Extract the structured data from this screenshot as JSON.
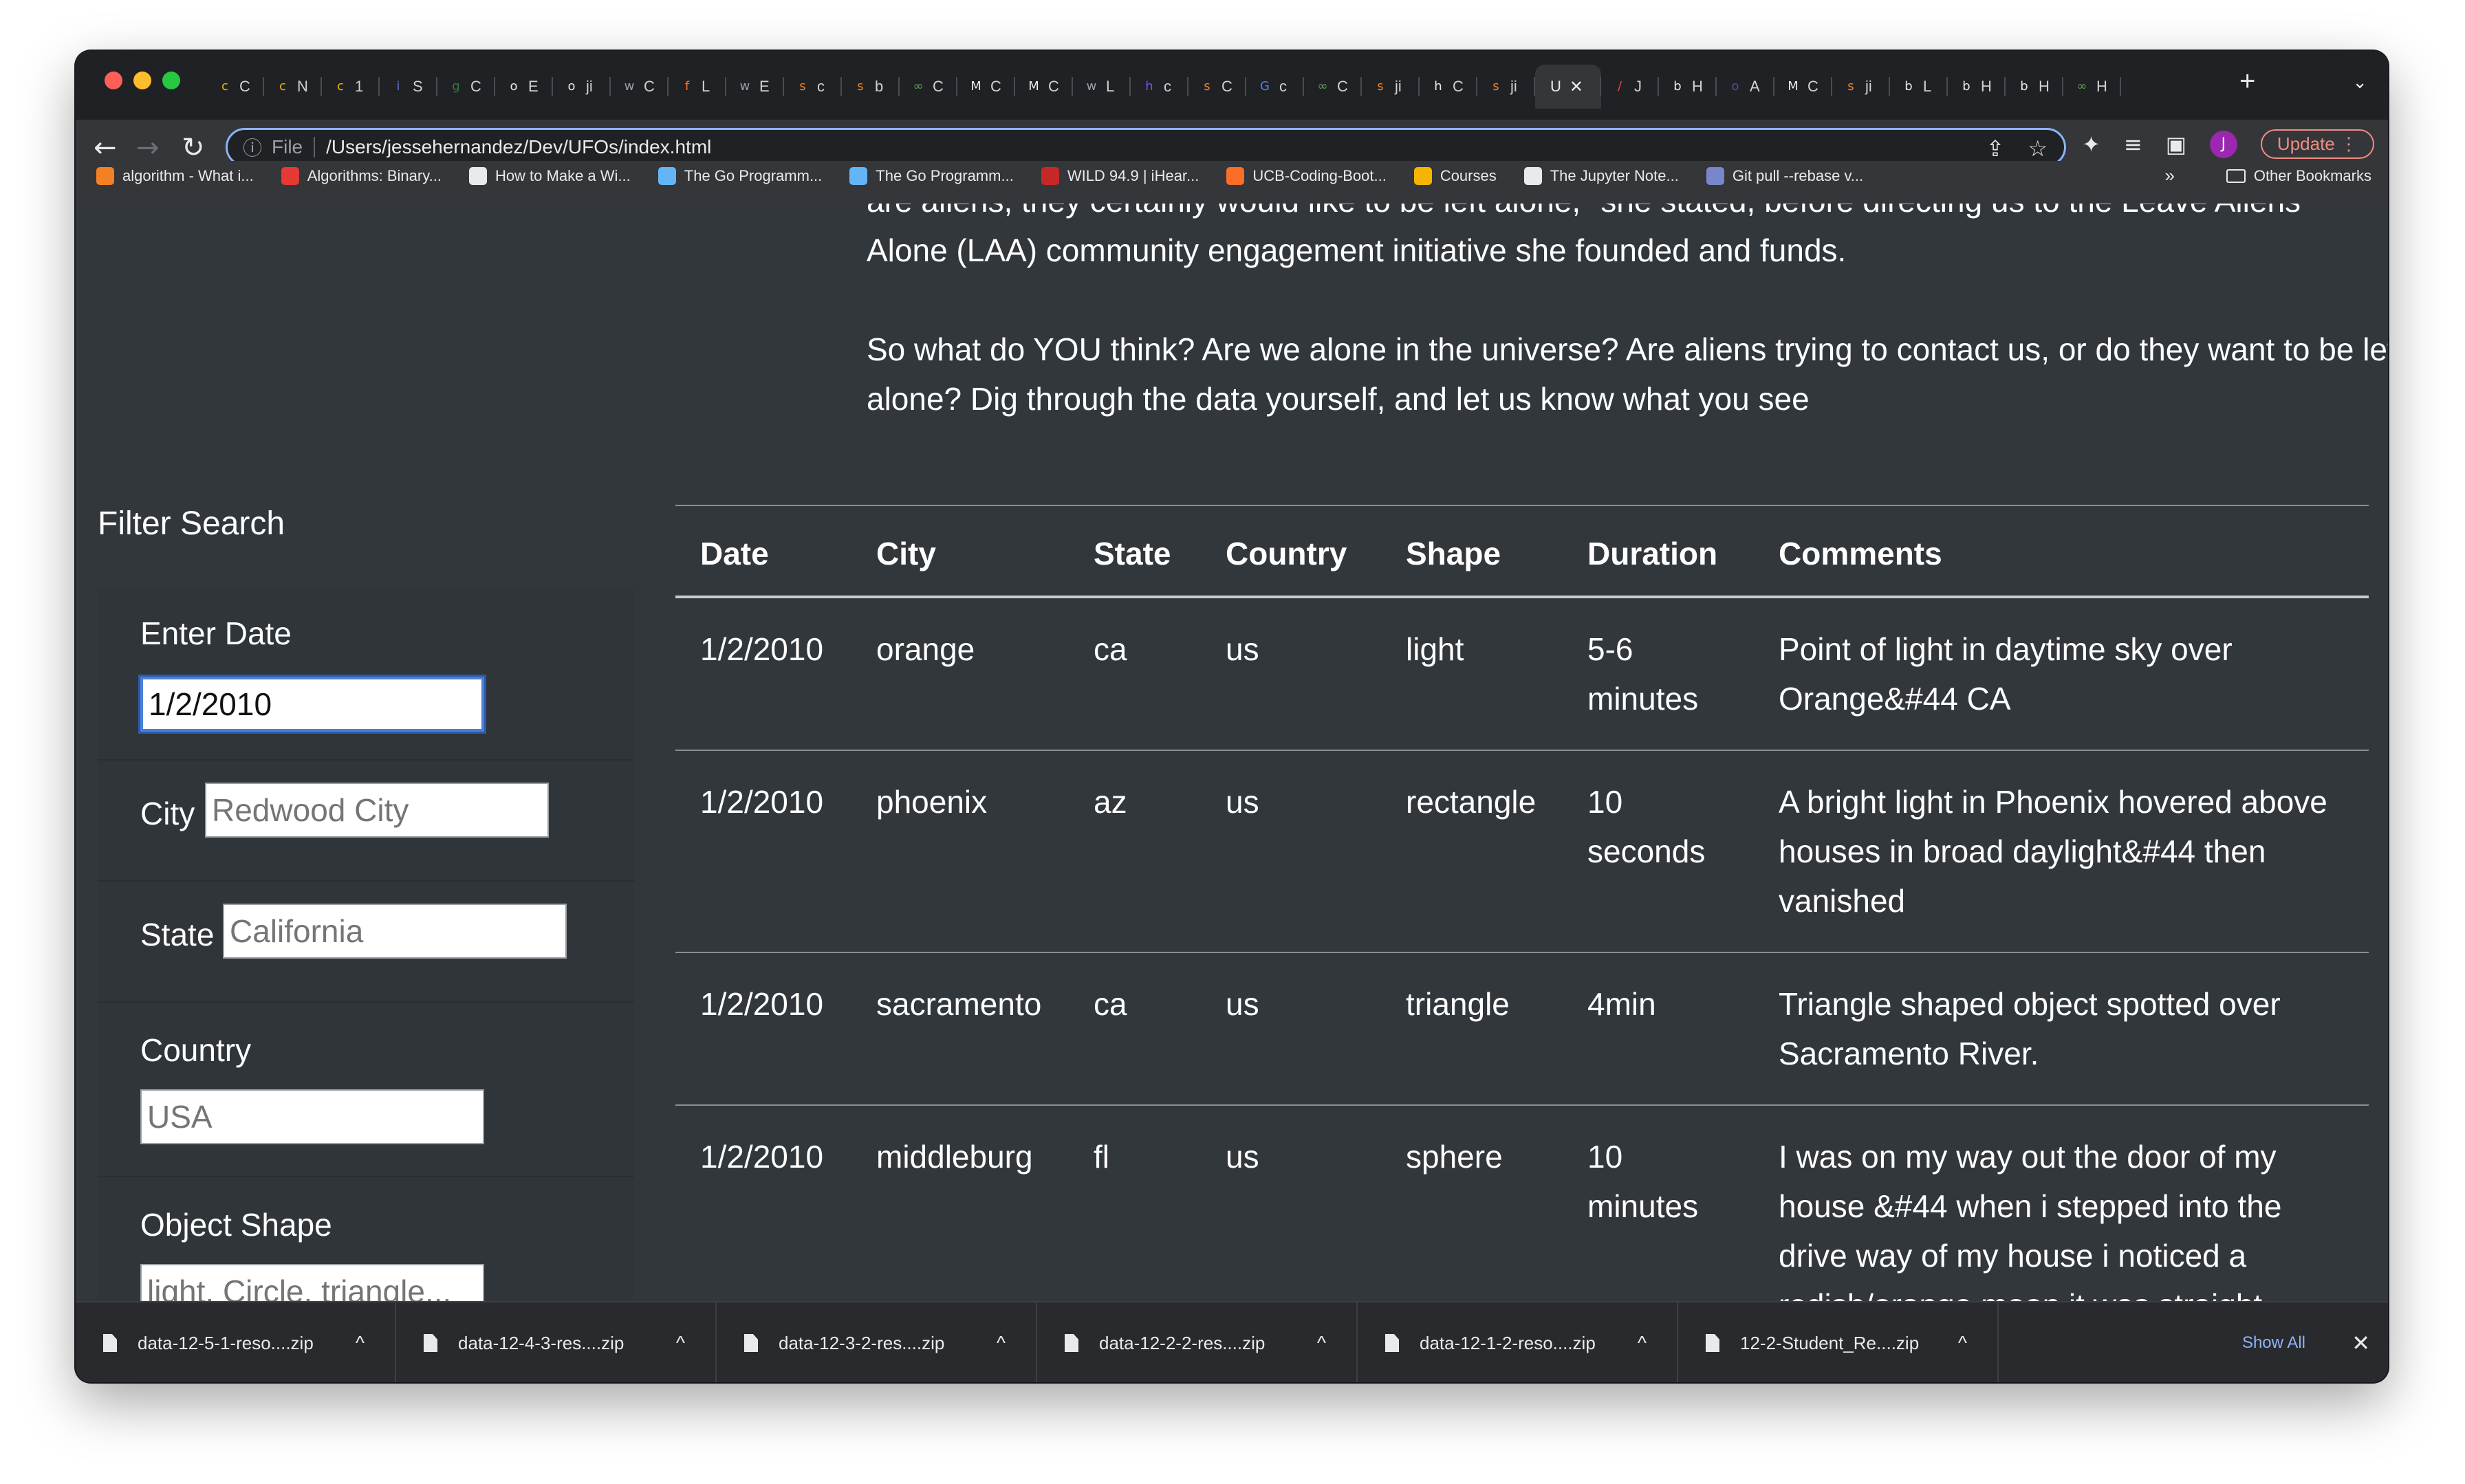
{
  "browser": {
    "tabs": [
      {
        "icon": "c",
        "label": "C",
        "color": "#f4b400"
      },
      {
        "icon": "c",
        "label": "N",
        "color": "#f4b400"
      },
      {
        "icon": "c",
        "label": "1",
        "color": "#f4b400"
      },
      {
        "icon": "i",
        "label": "S",
        "color": "#5b6fd6"
      },
      {
        "icon": "g",
        "label": "C",
        "color": "#2e7d32"
      },
      {
        "icon": "o",
        "label": "E",
        "color": "#e8eaed"
      },
      {
        "icon": "o",
        "label": "ji",
        "color": "#e8eaed"
      },
      {
        "icon": "w",
        "label": "C",
        "color": "#9aa0a6"
      },
      {
        "icon": "f",
        "label": "L",
        "color": "#fc6d26"
      },
      {
        "icon": "w",
        "label": "E",
        "color": "#9aa0a6"
      },
      {
        "icon": "s",
        "label": "c",
        "color": "#f48024"
      },
      {
        "icon": "s",
        "label": "b",
        "color": "#f48024"
      },
      {
        "icon": "∞",
        "label": "C",
        "color": "#57a64a"
      },
      {
        "icon": "M",
        "label": "C",
        "color": "#e8eaed"
      },
      {
        "icon": "M",
        "label": "C",
        "color": "#e8eaed"
      },
      {
        "icon": "w",
        "label": "L",
        "color": "#9aa0a6"
      },
      {
        "icon": "h",
        "label": "c",
        "color": "#7c4dff"
      },
      {
        "icon": "s",
        "label": "C",
        "color": "#f48024"
      },
      {
        "icon": "G",
        "label": "c",
        "color": "#4285f4"
      },
      {
        "icon": "∞",
        "label": "C",
        "color": "#57a64a"
      },
      {
        "icon": "s",
        "label": "ji",
        "color": "#f48024"
      },
      {
        "icon": "h",
        "label": "C",
        "color": "#e8eaed"
      },
      {
        "icon": "s",
        "label": "ji",
        "color": "#f48024"
      }
    ],
    "active_tab": {
      "label": "U"
    },
    "tabs_after": [
      {
        "icon": "/",
        "label": "J",
        "color": "#e74c3c"
      },
      {
        "icon": "b",
        "label": "H",
        "color": "#e8eaed"
      },
      {
        "icon": "o",
        "label": "A",
        "color": "#3f51b5"
      },
      {
        "icon": "M",
        "label": "C",
        "color": "#e8eaed"
      },
      {
        "icon": "s",
        "label": "ji",
        "color": "#f48024"
      },
      {
        "icon": "b",
        "label": "L",
        "color": "#e8eaed"
      },
      {
        "icon": "b",
        "label": "H",
        "color": "#e8eaed"
      },
      {
        "icon": "b",
        "label": "H",
        "color": "#e8eaed"
      },
      {
        "icon": "∞",
        "label": "H",
        "color": "#57a64a"
      }
    ],
    "address": {
      "scheme": "File",
      "url": "/Users/jessehernandez/Dev/UFOs/index.html"
    },
    "update_label": "Update",
    "avatar_initial": "J"
  },
  "bookmarks": {
    "items": [
      {
        "label": "algorithm - What i...",
        "color": "#f48024"
      },
      {
        "label": "Algorithms: Binary...",
        "color": "#e53935"
      },
      {
        "label": "How to Make a Wi...",
        "color": "#e8eaed"
      },
      {
        "label": "The Go Programm...",
        "color": "#64b5f6"
      },
      {
        "label": "The Go Programm...",
        "color": "#64b5f6"
      },
      {
        "label": "WILD 94.9 | iHear...",
        "color": "#c62828"
      },
      {
        "label": "UCB-Coding-Boot...",
        "color": "#fc6d26"
      },
      {
        "label": "Courses",
        "color": "#f4b400"
      },
      {
        "label": "The Jupyter Note...",
        "color": "#e8eaed"
      },
      {
        "label": "Git pull --rebase v...",
        "color": "#7986cb"
      }
    ],
    "more": "»",
    "other": "Other Bookmarks"
  },
  "article": {
    "line_partial": "are aliens, they certainly would like to be left alone,\" she stated, before directing us to the Leave Aliens",
    "line_1": "Alone (LAA) community engagement initiative she founded and funds.",
    "para_2": "So what do YOU think? Are we alone in the universe? Are aliens trying to contact us, or do they want to be left alone? Dig through the data yourself, and let us know what you see"
  },
  "filter": {
    "title": "Filter Search",
    "date_label": "Enter Date",
    "date_value": "1/2/2010",
    "city_label": "City",
    "city_placeholder": "Redwood City",
    "state_label": "State",
    "state_placeholder": "California",
    "country_label": "Country",
    "country_placeholder": "USA",
    "shape_label": "Object Shape",
    "shape_placeholder": "light, Circle, triangle..."
  },
  "table": {
    "headers": [
      "Date",
      "City",
      "State",
      "Country",
      "Shape",
      "Duration",
      "Comments"
    ],
    "rows": [
      [
        "1/2/2010",
        "orange",
        "ca",
        "us",
        "light",
        "5-6 minutes",
        "Point of light in daytime sky over Orange&#44 CA"
      ],
      [
        "1/2/2010",
        "phoenix",
        "az",
        "us",
        "rectangle",
        "10 seconds",
        "A bright light in Phoenix hovered above houses in broad daylight&#44 then vanished"
      ],
      [
        "1/2/2010",
        "sacramento",
        "ca",
        "us",
        "triangle",
        "4min",
        "Triangle shaped object spotted over Sacramento River."
      ],
      [
        "1/2/2010",
        "middleburg",
        "fl",
        "us",
        "sphere",
        "10 minutes",
        "I was on my way out the door of my house &#44 when i stepped into the drive way of my house i noticed a redish/orange moon it was straight"
      ]
    ]
  },
  "downloads": {
    "items": [
      "data-12-5-1-reso....zip",
      "data-12-4-3-res....zip",
      "data-12-3-2-res....zip",
      "data-12-2-2-res....zip",
      "data-12-1-2-reso....zip",
      "12-2-Student_Re....zip"
    ],
    "show_all": "Show All"
  }
}
